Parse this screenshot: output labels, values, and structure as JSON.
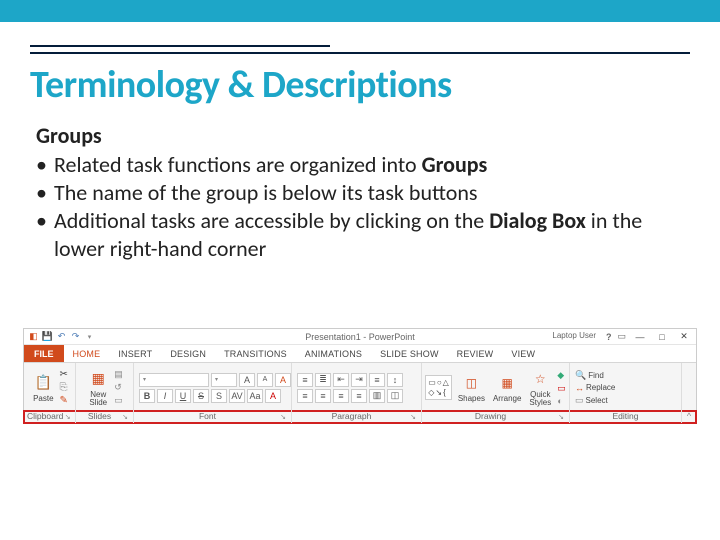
{
  "slide": {
    "title": "Terminology & Descriptions",
    "subhead": "Groups",
    "bullets": [
      {
        "pre": "Related task functions are organized into ",
        "bold": "Groups",
        "post": ""
      },
      {
        "pre": "The name of the group is below its task buttons",
        "bold": "",
        "post": ""
      },
      {
        "pre": "Additional tasks are accessible by clicking on the ",
        "bold": "Dialog Box",
        "post": " in the lower right-hand corner"
      }
    ]
  },
  "ribbon": {
    "window_title": "Presentation1 - PowerPoint",
    "account": "Laptop User",
    "file_tab": "FILE",
    "tabs": [
      "HOME",
      "INSERT",
      "DESIGN",
      "TRANSITIONS",
      "ANIMATIONS",
      "SLIDE SHOW",
      "REVIEW",
      "VIEW"
    ],
    "active_tab": "HOME",
    "groups": [
      {
        "name": "Clipboard",
        "launcher": true
      },
      {
        "name": "Slides",
        "launcher": true
      },
      {
        "name": "Font",
        "launcher": true
      },
      {
        "name": "Paragraph",
        "launcher": true
      },
      {
        "name": "Drawing",
        "launcher": true
      },
      {
        "name": "Editing",
        "launcher": false
      }
    ],
    "paste": "Paste",
    "new_slide": "New\nSlide",
    "shapes": "Shapes",
    "arrange": "Arrange",
    "quick_styles": "Quick\nStyles",
    "find": "Find",
    "replace": "Replace",
    "select": "Select"
  }
}
